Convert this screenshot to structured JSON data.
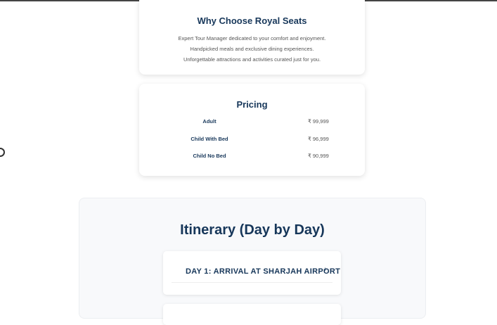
{
  "why": {
    "title": "Why Choose Royal Seats",
    "points": [
      "Expert Tour Manager dedicated to your comfort and enjoyment.",
      "Handpicked meals and exclusive dining experiences.",
      "Unforgettable attractions and activities curated just for you."
    ]
  },
  "pricing": {
    "title": "Pricing",
    "rows": [
      {
        "label": "Adult",
        "price": "₹ 99,999"
      },
      {
        "label": "Child With Bed",
        "price": "₹ 96,999"
      },
      {
        "label": "Child No Bed",
        "price": "₹ 90,999"
      }
    ]
  },
  "itinerary": {
    "title": "Itinerary (Day by Day)",
    "days": [
      {
        "title": "DAY 1: ARRIVAL AT SHARJAH AIRPORT",
        "toggle": "+"
      }
    ]
  }
}
